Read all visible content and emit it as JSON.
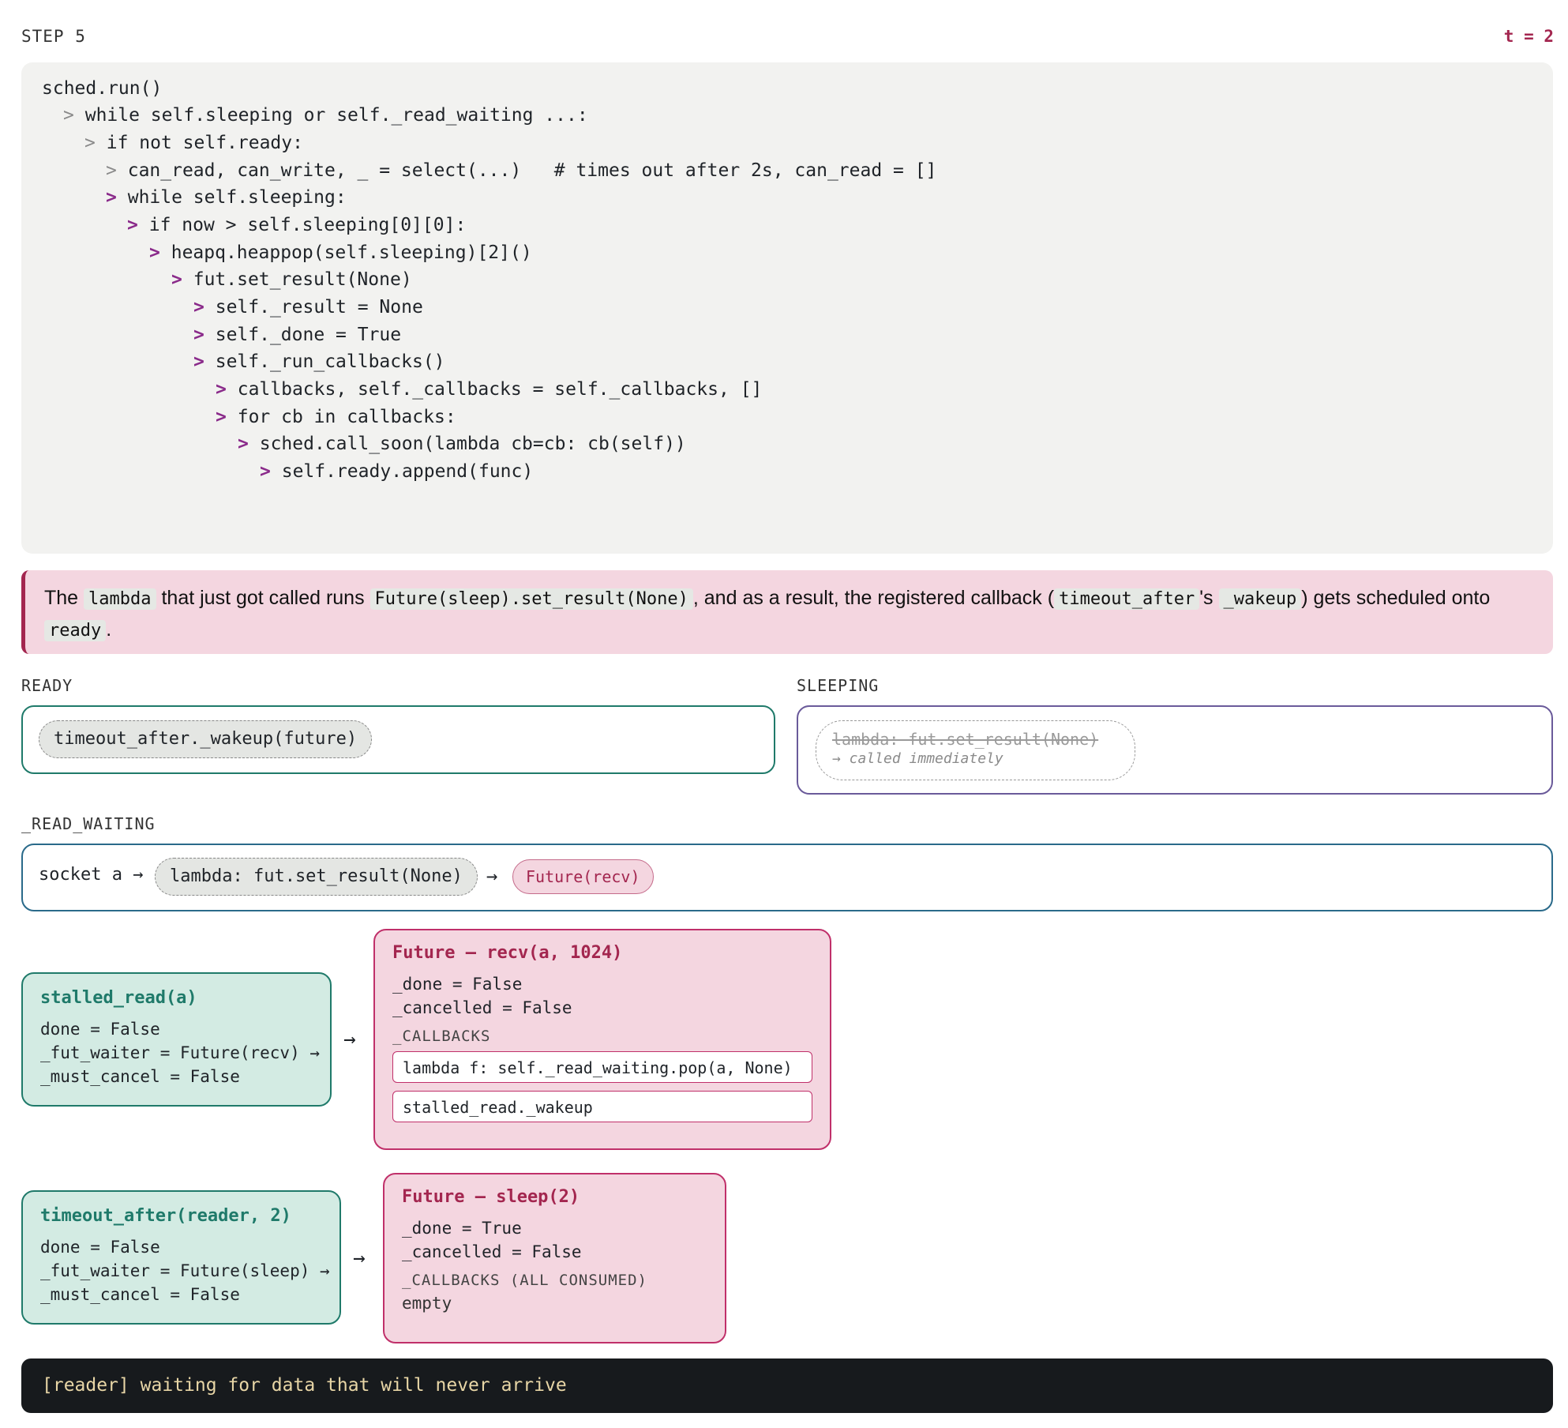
{
  "header": {
    "step": "STEP 5",
    "time": "t = 2"
  },
  "code": [
    {
      "text": "sched.run()",
      "arrow": "",
      "indent": 0,
      "active": false
    },
    {
      "text": "while self.sleeping or self._read_waiting ...:",
      "arrow": ">",
      "indent": 1,
      "active": false
    },
    {
      "text": "if not self.ready:",
      "arrow": ">",
      "indent": 2,
      "active": false
    },
    {
      "text": "can_read, can_write, _ = select(...)   # times out after 2s, can_read = []",
      "arrow": ">",
      "indent": 3,
      "active": false
    },
    {
      "text": "while self.sleeping:",
      "arrow": ">",
      "indent": 3,
      "active": true
    },
    {
      "text": "if now > self.sleeping[0][0]:",
      "arrow": ">",
      "indent": 4,
      "active": true
    },
    {
      "text": "heapq.heappop(self.sleeping)[2]()",
      "arrow": ">",
      "indent": 5,
      "active": true
    },
    {
      "text": "fut.set_result(None)",
      "arrow": ">",
      "indent": 6,
      "active": true
    },
    {
      "text": "self._result = None",
      "arrow": ">",
      "indent": 7,
      "active": true
    },
    {
      "text": "self._done = True",
      "arrow": ">",
      "indent": 7,
      "active": true
    },
    {
      "text": "self._run_callbacks()",
      "arrow": ">",
      "indent": 7,
      "active": true
    },
    {
      "text": "callbacks, self._callbacks = self._callbacks, []",
      "arrow": ">",
      "indent": 8,
      "active": true
    },
    {
      "text": "for cb in callbacks:",
      "arrow": ">",
      "indent": 8,
      "active": true
    },
    {
      "text": "sched.call_soon(lambda cb=cb: cb(self))",
      "arrow": ">",
      "indent": 9,
      "active": true
    },
    {
      "text": "self.ready.append(func)",
      "arrow": ">",
      "indent": 10,
      "active": true
    }
  ],
  "explanation": {
    "t1": "The",
    "c1": "lambda",
    "t2": "that just got called runs",
    "c2": "Future(sleep).set_result(None)",
    "t3": ", and as a result, the registered callback (",
    "c3": "timeout_after",
    "t4": "'s",
    "c4": "_wakeup",
    "t5": ") gets scheduled onto",
    "c5": "ready",
    "t6": "."
  },
  "ready": {
    "label": "READY",
    "items": [
      "timeout_after._wakeup(future)"
    ]
  },
  "sleeping": {
    "label": "SLEEPING",
    "item": "lambda: fut.set_result(None)",
    "note": "→ called immediately"
  },
  "read_waiting": {
    "label": "_READ_WAITING",
    "key": "socket a →",
    "callback": "lambda: fut.set_result(None)",
    "arrow": "→",
    "future": "Future(recv)"
  },
  "task1": {
    "title": "stalled_read(a)",
    "fields": [
      "done = False",
      "_fut_waiter = Future(recv) →",
      "_must_cancel = False"
    ],
    "arrow": "→"
  },
  "future1": {
    "title": "Future — recv(a, 1024)",
    "fields": [
      "_done = False",
      "_cancelled = False"
    ],
    "callbacks_label": "_CALLBACKS",
    "callbacks": [
      "lambda f: self._read_waiting.pop(a, None)",
      "stalled_read._wakeup"
    ]
  },
  "task2": {
    "title": "timeout_after(reader, 2)",
    "fields": [
      "done = False",
      "_fut_waiter = Future(sleep) →",
      "_must_cancel = False"
    ],
    "arrow": "→"
  },
  "future2": {
    "title": "Future — sleep(2)",
    "fields": [
      "_done = True",
      "_cancelled = False"
    ],
    "callbacks_label": "_CALLBACKS (ALL CONSUMED)",
    "empty": "empty"
  },
  "terminal": {
    "text": "[reader] waiting for data that will never arrive"
  },
  "colors": {
    "accent": "#a3264f",
    "teal": "#1f7a6a",
    "teal_bg": "#d3ebe3",
    "pink_bg": "#f4d6e0",
    "purple": "#6a5a9a",
    "blue_border": "#2a6a8a"
  }
}
